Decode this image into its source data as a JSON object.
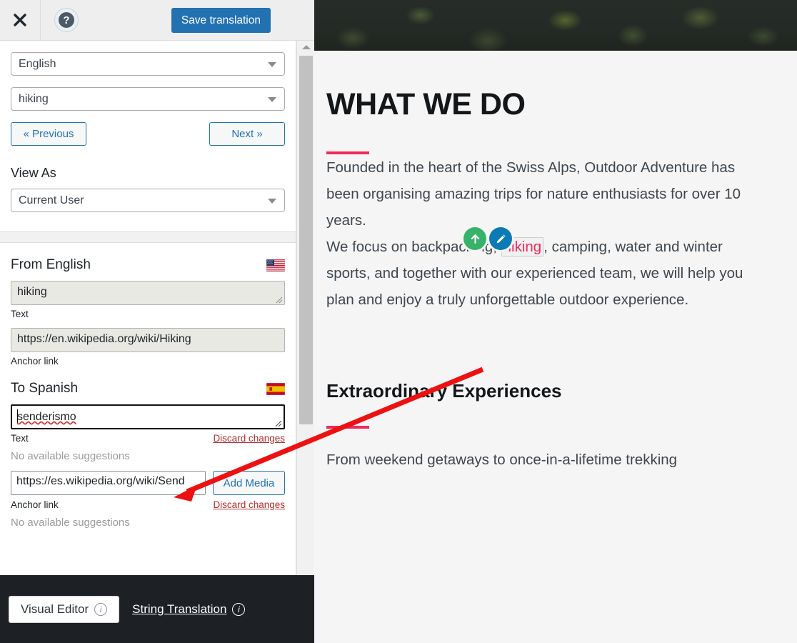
{
  "toolbar": {
    "close_icon": "close-icon",
    "help_icon": "help-icon",
    "help_glyph": "?",
    "save_label": "Save translation",
    "accent_blue": "#2271b1"
  },
  "sidebar": {
    "language_select": {
      "value": "English",
      "icon": "chevron-down-icon"
    },
    "string_select": {
      "value": "hiking",
      "icon": "chevron-down-icon"
    },
    "prev_label": "« Previous",
    "next_label": "Next »",
    "view_as_label": "View As",
    "view_as_select": {
      "value": "Current User",
      "icon": "chevron-down-icon"
    },
    "source": {
      "title": "From English",
      "flag": "us-flag-icon",
      "text_value": "hiking",
      "text_label": "Text",
      "link_value": "https://en.wikipedia.org/wiki/Hiking",
      "link_label": "Anchor link"
    },
    "target": {
      "title": "To Spanish",
      "flag": "es-flag-icon",
      "text_value": "senderismo",
      "text_label": "Text",
      "text_discard": "Discard changes",
      "text_suggestions": "No available suggestions",
      "link_value": "https://es.wikipedia.org/wiki/Send",
      "link_label": "Anchor link",
      "add_media_label": "Add Media",
      "link_discard": "Discard changes",
      "link_suggestions": "No available suggestions"
    },
    "scrollbar": {
      "up_icon": "scroll-up-arrow-icon"
    }
  },
  "footer": {
    "visual_editor_label": "Visual Editor",
    "visual_editor_info": "i",
    "string_translation_label": "String Translation",
    "string_translation_info": "i",
    "background": "#1d2126"
  },
  "content": {
    "hero_image": "forest-aerial-photo",
    "heading": "WHAT WE DO",
    "paragraph1": "Founded in the heart of the Swiss Alps, Outdoor Adventure has been organising amazing trips for nature enthusiasts for over 10 years.",
    "paragraph2_before": "We focus on backpacking, ",
    "paragraph2_link": "hiking",
    "paragraph2_after": ", camping, water and winter sports, and together with our experienced team, we will help you plan and enjoy a truly unforgettable outdoor experience.",
    "subheading": "Extraordinary Experiences",
    "paragraph3": "From weekend getaways to once-in-a-lifetime trekking",
    "accent_pink": "#f2295b",
    "fab_up_icon": "arrow-up-icon",
    "fab_edit_icon": "pencil-edit-icon"
  },
  "annotation": {
    "arrow_color": "#ee1111",
    "arrow_icon": "red-pointer-arrow"
  }
}
